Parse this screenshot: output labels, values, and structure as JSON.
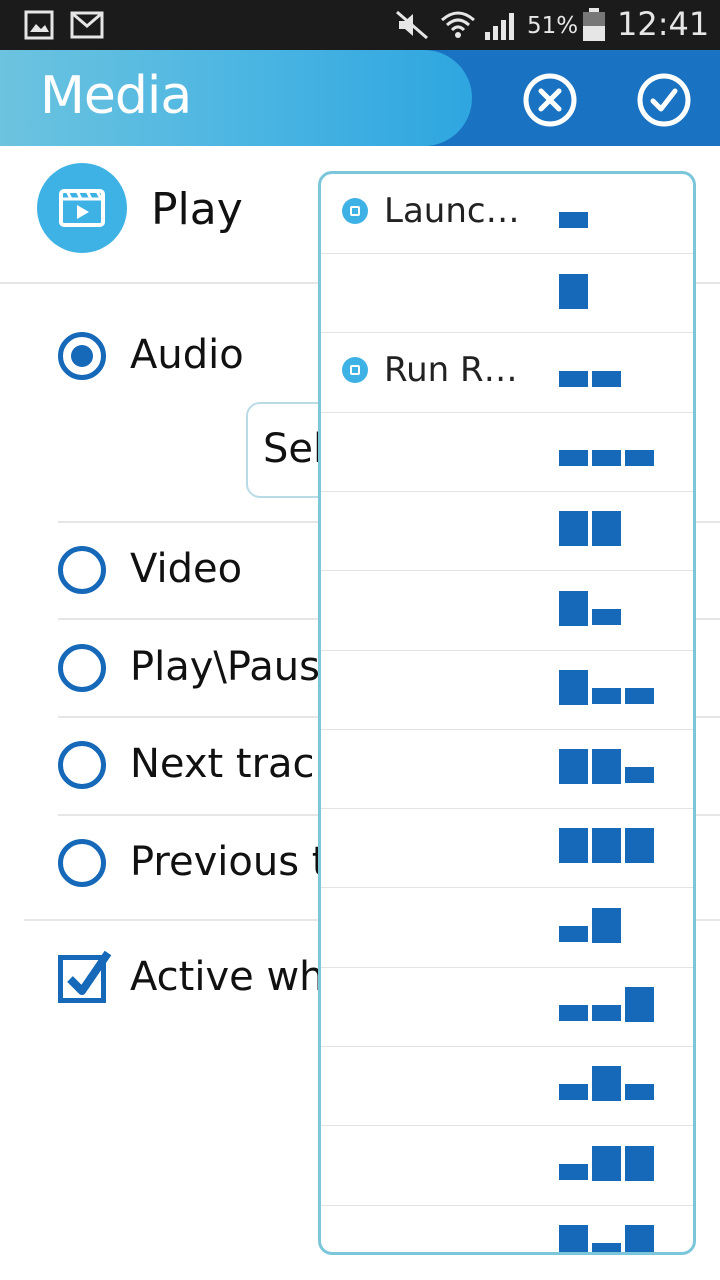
{
  "status_bar": {
    "icons": [
      "gallery-icon",
      "gmail-icon",
      "mute-icon",
      "wifi-icon",
      "signal-icon",
      "battery-icon"
    ],
    "battery": "51%",
    "time": "12:41"
  },
  "app_bar": {
    "title": "Media",
    "cancel_icon": "close-circle-icon",
    "confirm_icon": "check-circle-icon"
  },
  "header": {
    "label": "Play",
    "icon": "video-icon"
  },
  "options": [
    {
      "label": "Audio",
      "checked": true
    },
    {
      "label": "Video",
      "checked": false
    },
    {
      "label": "Play\\Paus",
      "checked": false
    },
    {
      "label": "Next track",
      "checked": false
    },
    {
      "label": "Previous tr",
      "checked": false
    }
  ],
  "select": {
    "text": "Sel"
  },
  "active_when": {
    "label": "Active whe",
    "checked": true
  },
  "popup": {
    "rows": [
      {
        "label": "Launc…",
        "icon": "camera-icon",
        "pattern": [
          1
        ]
      },
      {
        "label": "",
        "pattern": [
          3
        ]
      },
      {
        "label": "Run R…",
        "icon": "calculator-icon",
        "pattern": [
          1,
          1
        ]
      },
      {
        "label": "",
        "pattern": [
          1,
          1,
          1
        ]
      },
      {
        "label": "",
        "pattern": [
          2,
          2
        ]
      },
      {
        "label": "",
        "pattern": [
          2,
          1
        ]
      },
      {
        "label": "",
        "pattern": [
          2,
          1,
          1
        ]
      },
      {
        "label": "",
        "pattern": [
          2,
          2,
          1
        ]
      },
      {
        "label": "",
        "pattern": [
          2,
          2,
          2
        ]
      },
      {
        "label": "",
        "pattern": [
          1,
          2
        ]
      },
      {
        "label": "",
        "pattern": [
          1,
          1,
          2
        ]
      },
      {
        "label": "",
        "pattern": [
          1,
          2,
          1
        ]
      },
      {
        "label": "",
        "pattern": [
          1,
          2,
          2
        ]
      },
      {
        "label": "",
        "pattern": [
          2,
          1,
          2
        ]
      }
    ]
  },
  "colors": {
    "accent": "#1668b8",
    "title_gradient": "#4db6e2",
    "popup_border": "#7cc6da"
  }
}
